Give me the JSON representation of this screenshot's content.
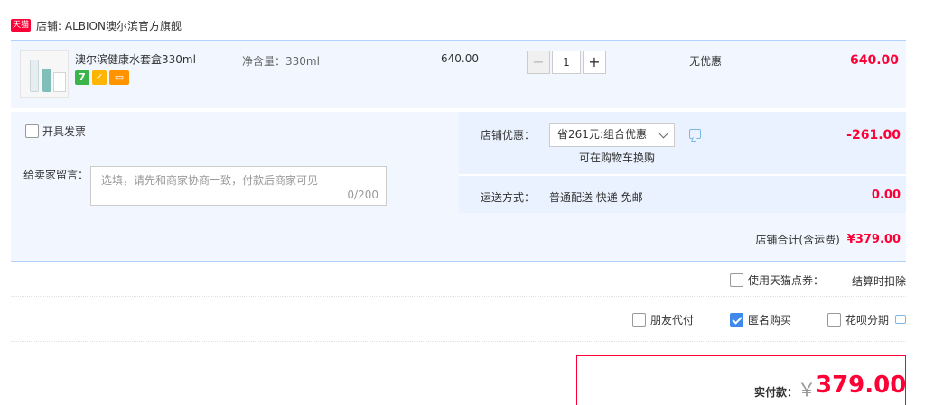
{
  "shop": {
    "badge": "天猫",
    "label": "店铺: ALBION澳尔滨官方旗舰"
  },
  "item": {
    "title": "澳尔滨健康水套盒330ml",
    "spec": "净含量：330ml",
    "price": "640.00",
    "quantity": "1",
    "discount": "无优惠",
    "total": "640.00",
    "badges": [
      {
        "icon": "seven-day-return-icon",
        "text": "7"
      },
      {
        "icon": "verified-icon",
        "text": "✓"
      },
      {
        "icon": "card-icon",
        "text": "▭"
      }
    ]
  },
  "options": {
    "invoice_label": "开具发票",
    "message_label": "给卖家留言：",
    "message_placeholder": "选填，请先和商家协商一致，付款后商家可见",
    "message_count": "0/200",
    "promo_label": "店铺优惠：",
    "promo_selected": "省261元:组合优惠",
    "promo_note": "可在购物车换购",
    "promo_amount": "-261.00",
    "shipping_label": "运送方式：",
    "shipping_value": "普通配送 快递 免邮",
    "shipping_amount": "0.00",
    "shop_total_label": "店铺合计(含运费)",
    "shop_total_amount": "¥379.00"
  },
  "coupon": {
    "label": "使用天猫点券：",
    "note": "结算时扣除"
  },
  "flags": {
    "friend_pay": {
      "label": "朋友代付",
      "checked": false
    },
    "anonymous": {
      "label": "匿名购买",
      "checked": true
    },
    "huabei": {
      "label": "花呗分期",
      "checked": false
    }
  },
  "payment": {
    "label": "实付款：",
    "currency": "￥",
    "amount": "379.00"
  },
  "colors": {
    "accent_red": "#ff0036",
    "light_blue_bg": "#f2f7ff",
    "checkbox_blue": "#3f89ec"
  }
}
